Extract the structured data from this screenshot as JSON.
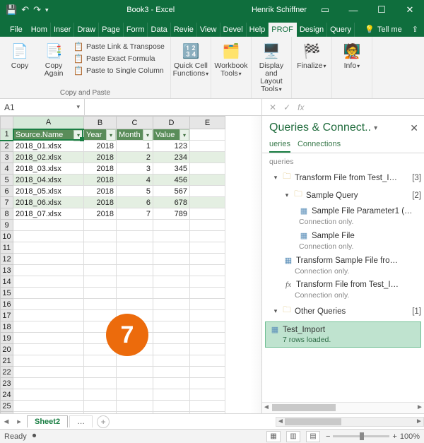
{
  "titlebar": {
    "title": "Book3 - Excel",
    "user": "Henrik Schiffner"
  },
  "tabs": {
    "file": "File",
    "items": [
      "Hom",
      "Inser",
      "Draw",
      "Page",
      "Form",
      "Data",
      "Revie",
      "View",
      "Devel",
      "Help",
      "PROF",
      "Design",
      "Query"
    ],
    "active": "PROF",
    "tell": "Tell me"
  },
  "ribbon": {
    "copy": "Copy",
    "copy_again": "Copy Again",
    "paste_link": "Paste Link & Transpose",
    "paste_exact": "Paste Exact Formula",
    "paste_single_col": "Paste to Single Column",
    "group_copy": "Copy and Paste",
    "quickcell": "Quick Cell Functions",
    "workbook": "Workbook Tools",
    "display": "Display and Layout Tools",
    "finalize": "Finalize",
    "info": "Info"
  },
  "namebox": "A1",
  "columns": [
    "A",
    "B",
    "C",
    "D",
    "E"
  ],
  "table": {
    "headers": [
      "Source.Name",
      "Year",
      "Month",
      "Value"
    ],
    "rows": [
      [
        "2018_01.xlsx",
        "2018",
        "1",
        "123"
      ],
      [
        "2018_02.xlsx",
        "2018",
        "2",
        "234"
      ],
      [
        "2018_03.xlsx",
        "2018",
        "3",
        "345"
      ],
      [
        "2018_04.xlsx",
        "2018",
        "4",
        "456"
      ],
      [
        "2018_05.xlsx",
        "2018",
        "5",
        "567"
      ],
      [
        "2018_06.xlsx",
        "2018",
        "6",
        "678"
      ],
      [
        "2018_07.xlsx",
        "2018",
        "7",
        "789"
      ]
    ]
  },
  "badge": "7",
  "sheettab": "Sheet2",
  "sheettab2": "…",
  "pane": {
    "title": "Queries & Connect..",
    "tab_q": "ueries",
    "tab_c": "Connections",
    "sublabel": "queries",
    "group1": "Transform File from Test_I…",
    "group1_cnt": "[3]",
    "group1a": "Sample Query",
    "group1a_cnt": "[2]",
    "q_param": "Sample File Parameter1 (…",
    "q_param_sub": "Connection only.",
    "q_sample": "Sample File",
    "q_sample_sub": "Connection only.",
    "q_transform_sample": "Transform Sample File fro…",
    "q_transform_sample_sub": "Connection only.",
    "q_transform_file": "Transform File from Test_I…",
    "q_transform_file_sub": "Connection only.",
    "group2": "Other Queries",
    "group2_cnt": "[1]",
    "q_selected": "Test_Import",
    "q_selected_sub": "7 rows loaded."
  },
  "status": {
    "ready": "Ready",
    "rec": "",
    "zoom_minus": "−",
    "zoom_plus": "+",
    "zoom": "100%"
  }
}
